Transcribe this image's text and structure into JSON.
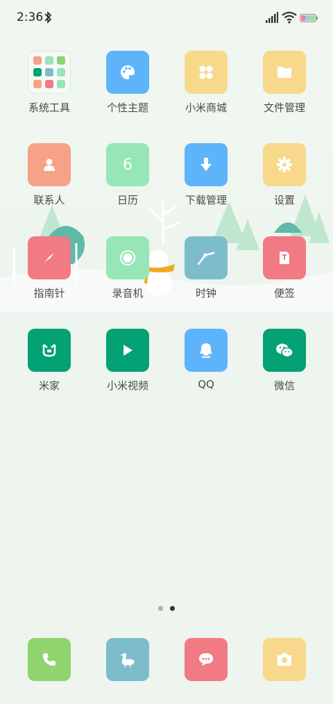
{
  "status": {
    "time": "2:36"
  },
  "apps": [
    {
      "label": "系统工具",
      "color": "folder",
      "icon": "folder-icon"
    },
    {
      "label": "个性主题",
      "color": "#5eb4fb",
      "icon": "palette-icon"
    },
    {
      "label": "小米商城",
      "color": "#f8d98b",
      "icon": "mi-store-icon"
    },
    {
      "label": "文件管理",
      "color": "#f8d98b",
      "icon": "file-folder-icon"
    },
    {
      "label": "联系人",
      "color": "#f7a187",
      "icon": "contact-icon"
    },
    {
      "label": "日历",
      "color": "#96e6b7",
      "icon": "calendar-icon",
      "day": "6"
    },
    {
      "label": "下载管理",
      "color": "#5eb4fb",
      "icon": "download-icon"
    },
    {
      "label": "设置",
      "color": "#f8d98b",
      "icon": "gear-icon"
    },
    {
      "label": "指南针",
      "color": "#f17a85",
      "icon": "compass-icon"
    },
    {
      "label": "录音机",
      "color": "#96e6b7",
      "icon": "recorder-icon"
    },
    {
      "label": "时钟",
      "color": "#7dbdcb",
      "icon": "clock-icon"
    },
    {
      "label": "便签",
      "color": "#f17a85",
      "icon": "notes-icon"
    },
    {
      "label": "米家",
      "color": "#03a173",
      "icon": "mijia-icon"
    },
    {
      "label": "小米视频",
      "color": "#03a173",
      "icon": "video-play-icon"
    },
    {
      "label": "QQ",
      "color": "#5eb4fb",
      "icon": "qq-icon"
    },
    {
      "label": "微信",
      "color": "#03a173",
      "icon": "wechat-icon"
    }
  ],
  "dock": [
    {
      "name": "phone",
      "color": "#8fd46f",
      "icon": "phone-icon"
    },
    {
      "name": "browser",
      "color": "#7dbdcb",
      "icon": "goose-icon"
    },
    {
      "name": "messages",
      "color": "#f17a85",
      "icon": "message-icon"
    },
    {
      "name": "camera",
      "color": "#f8d98b",
      "icon": "camera-icon"
    }
  ],
  "page_indicator": {
    "count": 2,
    "active": 1
  }
}
